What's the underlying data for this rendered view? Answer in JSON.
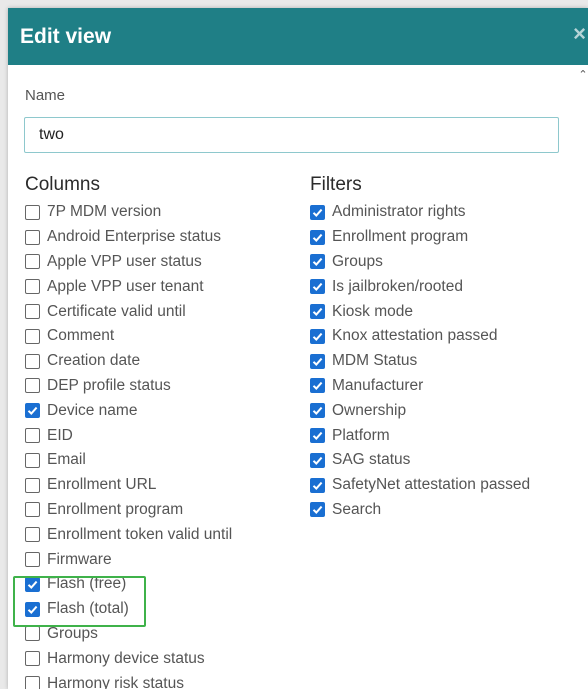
{
  "dialog": {
    "title": "Edit view",
    "close_glyph": "×",
    "scroll_up_glyph": "⌃"
  },
  "name": {
    "label": "Name",
    "value": "two"
  },
  "columns": {
    "heading": "Columns",
    "items": [
      {
        "label": "7P MDM version",
        "checked": false
      },
      {
        "label": "Android Enterprise status",
        "checked": false
      },
      {
        "label": "Apple VPP user status",
        "checked": false
      },
      {
        "label": "Apple VPP user tenant",
        "checked": false
      },
      {
        "label": "Certificate valid until",
        "checked": false
      },
      {
        "label": "Comment",
        "checked": false
      },
      {
        "label": "Creation date",
        "checked": false
      },
      {
        "label": "DEP profile status",
        "checked": false
      },
      {
        "label": "Device name",
        "checked": true
      },
      {
        "label": "EID",
        "checked": false
      },
      {
        "label": "Email",
        "checked": false
      },
      {
        "label": "Enrollment URL",
        "checked": false
      },
      {
        "label": "Enrollment program",
        "checked": false
      },
      {
        "label": "Enrollment token valid until",
        "checked": false
      },
      {
        "label": "Firmware",
        "checked": false
      },
      {
        "label": "Flash (free)",
        "checked": true
      },
      {
        "label": "Flash (total)",
        "checked": true
      },
      {
        "label": "Groups",
        "checked": false
      },
      {
        "label": "Harmony device status",
        "checked": false
      },
      {
        "label": "Harmony risk status",
        "checked": false
      }
    ]
  },
  "filters": {
    "heading": "Filters",
    "items": [
      {
        "label": "Administrator rights",
        "checked": true
      },
      {
        "label": "Enrollment program",
        "checked": true
      },
      {
        "label": "Groups",
        "checked": true
      },
      {
        "label": "Is jailbroken/rooted",
        "checked": true
      },
      {
        "label": "Kiosk mode",
        "checked": true
      },
      {
        "label": "Knox attestation passed",
        "checked": true
      },
      {
        "label": "MDM Status",
        "checked": true
      },
      {
        "label": "Manufacturer",
        "checked": true
      },
      {
        "label": "Ownership",
        "checked": true
      },
      {
        "label": "Platform",
        "checked": true
      },
      {
        "label": "SAG status",
        "checked": true
      },
      {
        "label": "SafetyNet attestation passed",
        "checked": true
      },
      {
        "label": "Search",
        "checked": true
      }
    ]
  },
  "colors": {
    "header_bg": "#1f7f86",
    "checkbox_checked": "#1a6fd2",
    "input_border": "#8ec8cd",
    "highlight_border": "#3fb24a"
  }
}
